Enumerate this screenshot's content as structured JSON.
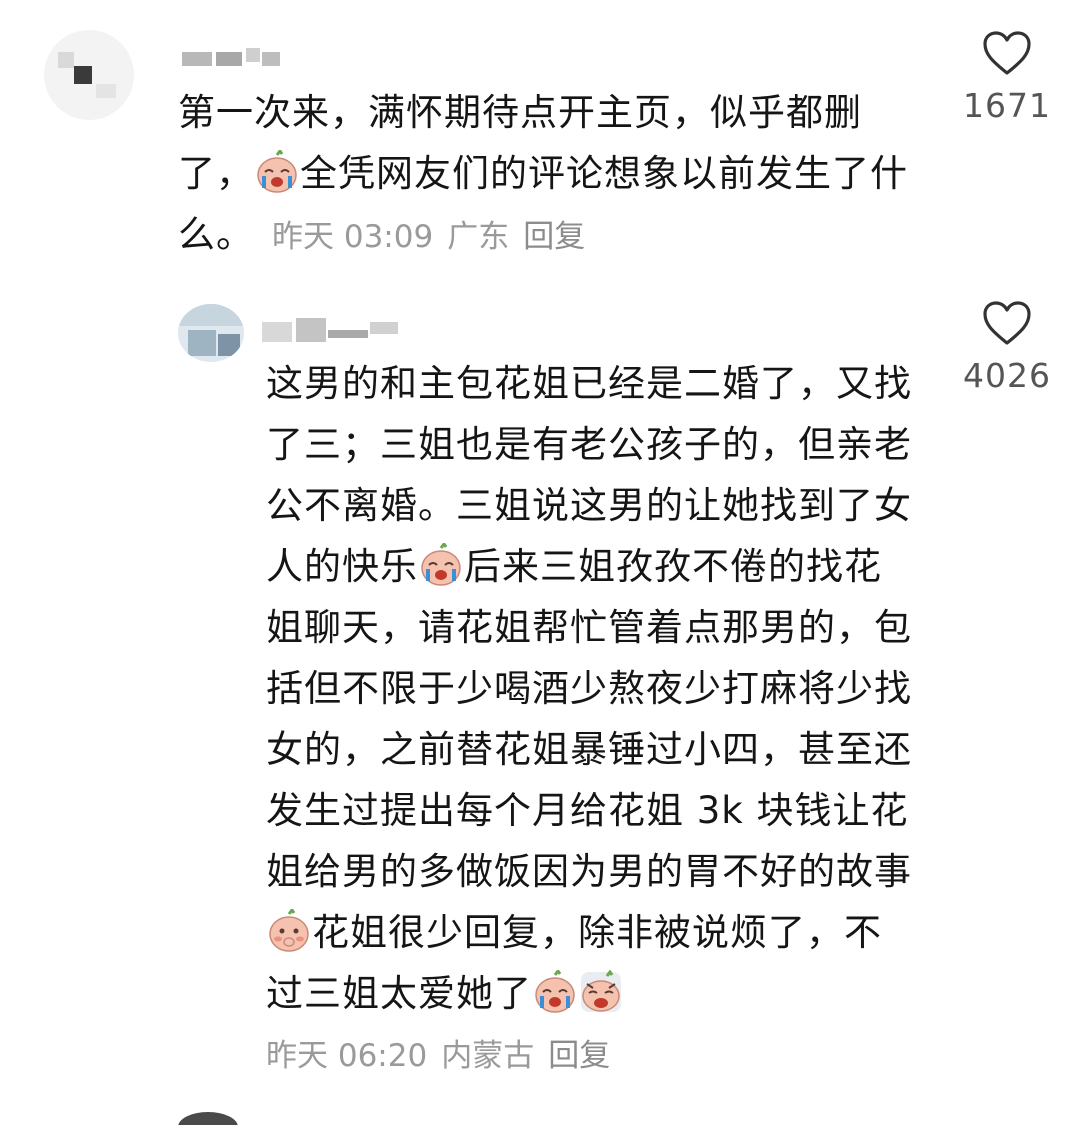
{
  "comments": [
    {
      "text_lines": "第一次来，满怀期待点开主页，似乎都删了，",
      "text_after_emoji": "全凭网友们的评论想象以前发生了什么。",
      "time": "昨天 03:09",
      "location": "广东",
      "reply": "回复",
      "likes": "1671"
    },
    {
      "part1": "这男的和主包花姐已经是二婚了，又找了三；三姐也是有老公孩子的，但亲老公不离婚。三姐说这男的让她找到了女人的快乐",
      "part2": "后来三姐孜孜不倦的找花姐聊天，请花姐帮忙管着点那男的，包括但不限于少喝酒少熬夜少打麻将少找女的，之前替花姐暴锤过小四，甚至还发生过提出每个月给花姐 3k 块钱让花姐给男的多做饭因为男的胃不好的故事",
      "part3": "花姐很少回复，除非被说烦了，不过三姐太爱她了",
      "time": "昨天 06:20",
      "location": "内蒙古",
      "reply": "回复",
      "likes": "4026"
    }
  ],
  "icons": {
    "like": "heart-outline-icon",
    "emoji_cry": "crying-sticker-icon",
    "emoji_shy": "shy-sticker-icon",
    "emoji_sob": "sobbing-sticker-icon"
  },
  "colors": {
    "text": "#151515",
    "meta": "#9a9a9a",
    "count": "#555555",
    "sticker": "#f4b8a6"
  }
}
